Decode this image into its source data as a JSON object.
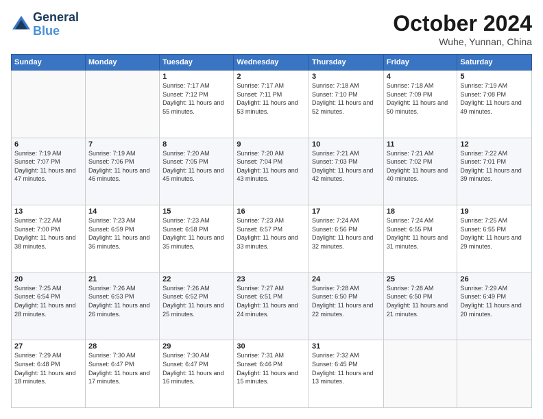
{
  "logo": {
    "line1": "General",
    "line2": "Blue"
  },
  "header": {
    "month": "October 2024",
    "location": "Wuhe, Yunnan, China"
  },
  "weekdays": [
    "Sunday",
    "Monday",
    "Tuesday",
    "Wednesday",
    "Thursday",
    "Friday",
    "Saturday"
  ],
  "weeks": [
    [
      {
        "day": "",
        "sunrise": "",
        "sunset": "",
        "daylight": ""
      },
      {
        "day": "",
        "sunrise": "",
        "sunset": "",
        "daylight": ""
      },
      {
        "day": "1",
        "sunrise": "Sunrise: 7:17 AM",
        "sunset": "Sunset: 7:12 PM",
        "daylight": "Daylight: 11 hours and 55 minutes."
      },
      {
        "day": "2",
        "sunrise": "Sunrise: 7:17 AM",
        "sunset": "Sunset: 7:11 PM",
        "daylight": "Daylight: 11 hours and 53 minutes."
      },
      {
        "day": "3",
        "sunrise": "Sunrise: 7:18 AM",
        "sunset": "Sunset: 7:10 PM",
        "daylight": "Daylight: 11 hours and 52 minutes."
      },
      {
        "day": "4",
        "sunrise": "Sunrise: 7:18 AM",
        "sunset": "Sunset: 7:09 PM",
        "daylight": "Daylight: 11 hours and 50 minutes."
      },
      {
        "day": "5",
        "sunrise": "Sunrise: 7:19 AM",
        "sunset": "Sunset: 7:08 PM",
        "daylight": "Daylight: 11 hours and 49 minutes."
      }
    ],
    [
      {
        "day": "6",
        "sunrise": "Sunrise: 7:19 AM",
        "sunset": "Sunset: 7:07 PM",
        "daylight": "Daylight: 11 hours and 47 minutes."
      },
      {
        "day": "7",
        "sunrise": "Sunrise: 7:19 AM",
        "sunset": "Sunset: 7:06 PM",
        "daylight": "Daylight: 11 hours and 46 minutes."
      },
      {
        "day": "8",
        "sunrise": "Sunrise: 7:20 AM",
        "sunset": "Sunset: 7:05 PM",
        "daylight": "Daylight: 11 hours and 45 minutes."
      },
      {
        "day": "9",
        "sunrise": "Sunrise: 7:20 AM",
        "sunset": "Sunset: 7:04 PM",
        "daylight": "Daylight: 11 hours and 43 minutes."
      },
      {
        "day": "10",
        "sunrise": "Sunrise: 7:21 AM",
        "sunset": "Sunset: 7:03 PM",
        "daylight": "Daylight: 11 hours and 42 minutes."
      },
      {
        "day": "11",
        "sunrise": "Sunrise: 7:21 AM",
        "sunset": "Sunset: 7:02 PM",
        "daylight": "Daylight: 11 hours and 40 minutes."
      },
      {
        "day": "12",
        "sunrise": "Sunrise: 7:22 AM",
        "sunset": "Sunset: 7:01 PM",
        "daylight": "Daylight: 11 hours and 39 minutes."
      }
    ],
    [
      {
        "day": "13",
        "sunrise": "Sunrise: 7:22 AM",
        "sunset": "Sunset: 7:00 PM",
        "daylight": "Daylight: 11 hours and 38 minutes."
      },
      {
        "day": "14",
        "sunrise": "Sunrise: 7:23 AM",
        "sunset": "Sunset: 6:59 PM",
        "daylight": "Daylight: 11 hours and 36 minutes."
      },
      {
        "day": "15",
        "sunrise": "Sunrise: 7:23 AM",
        "sunset": "Sunset: 6:58 PM",
        "daylight": "Daylight: 11 hours and 35 minutes."
      },
      {
        "day": "16",
        "sunrise": "Sunrise: 7:23 AM",
        "sunset": "Sunset: 6:57 PM",
        "daylight": "Daylight: 11 hours and 33 minutes."
      },
      {
        "day": "17",
        "sunrise": "Sunrise: 7:24 AM",
        "sunset": "Sunset: 6:56 PM",
        "daylight": "Daylight: 11 hours and 32 minutes."
      },
      {
        "day": "18",
        "sunrise": "Sunrise: 7:24 AM",
        "sunset": "Sunset: 6:55 PM",
        "daylight": "Daylight: 11 hours and 31 minutes."
      },
      {
        "day": "19",
        "sunrise": "Sunrise: 7:25 AM",
        "sunset": "Sunset: 6:55 PM",
        "daylight": "Daylight: 11 hours and 29 minutes."
      }
    ],
    [
      {
        "day": "20",
        "sunrise": "Sunrise: 7:25 AM",
        "sunset": "Sunset: 6:54 PM",
        "daylight": "Daylight: 11 hours and 28 minutes."
      },
      {
        "day": "21",
        "sunrise": "Sunrise: 7:26 AM",
        "sunset": "Sunset: 6:53 PM",
        "daylight": "Daylight: 11 hours and 26 minutes."
      },
      {
        "day": "22",
        "sunrise": "Sunrise: 7:26 AM",
        "sunset": "Sunset: 6:52 PM",
        "daylight": "Daylight: 11 hours and 25 minutes."
      },
      {
        "day": "23",
        "sunrise": "Sunrise: 7:27 AM",
        "sunset": "Sunset: 6:51 PM",
        "daylight": "Daylight: 11 hours and 24 minutes."
      },
      {
        "day": "24",
        "sunrise": "Sunrise: 7:28 AM",
        "sunset": "Sunset: 6:50 PM",
        "daylight": "Daylight: 11 hours and 22 minutes."
      },
      {
        "day": "25",
        "sunrise": "Sunrise: 7:28 AM",
        "sunset": "Sunset: 6:50 PM",
        "daylight": "Daylight: 11 hours and 21 minutes."
      },
      {
        "day": "26",
        "sunrise": "Sunrise: 7:29 AM",
        "sunset": "Sunset: 6:49 PM",
        "daylight": "Daylight: 11 hours and 20 minutes."
      }
    ],
    [
      {
        "day": "27",
        "sunrise": "Sunrise: 7:29 AM",
        "sunset": "Sunset: 6:48 PM",
        "daylight": "Daylight: 11 hours and 18 minutes."
      },
      {
        "day": "28",
        "sunrise": "Sunrise: 7:30 AM",
        "sunset": "Sunset: 6:47 PM",
        "daylight": "Daylight: 11 hours and 17 minutes."
      },
      {
        "day": "29",
        "sunrise": "Sunrise: 7:30 AM",
        "sunset": "Sunset: 6:47 PM",
        "daylight": "Daylight: 11 hours and 16 minutes."
      },
      {
        "day": "30",
        "sunrise": "Sunrise: 7:31 AM",
        "sunset": "Sunset: 6:46 PM",
        "daylight": "Daylight: 11 hours and 15 minutes."
      },
      {
        "day": "31",
        "sunrise": "Sunrise: 7:32 AM",
        "sunset": "Sunset: 6:45 PM",
        "daylight": "Daylight: 11 hours and 13 minutes."
      },
      {
        "day": "",
        "sunrise": "",
        "sunset": "",
        "daylight": ""
      },
      {
        "day": "",
        "sunrise": "",
        "sunset": "",
        "daylight": ""
      }
    ]
  ]
}
